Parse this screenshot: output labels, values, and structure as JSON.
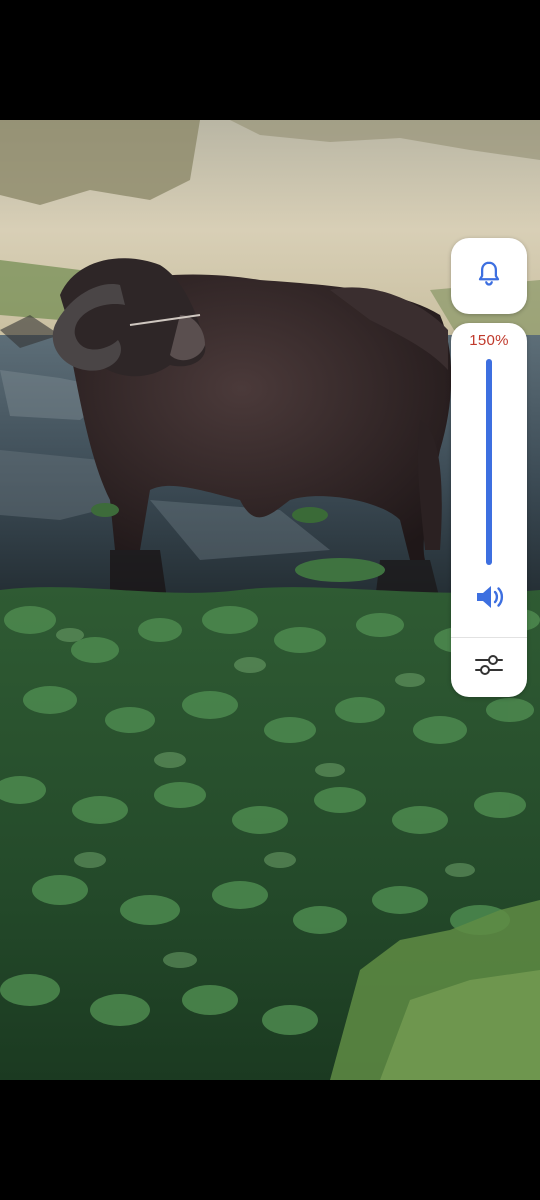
{
  "volume": {
    "percent_label": "150%",
    "level_fraction": 1.0,
    "accent_color": "#3d6fe0",
    "percent_color": "#c0392b"
  },
  "icons": {
    "ringer": "bell-icon",
    "media": "speaker-icon",
    "settings": "sliders-icon"
  },
  "photo": {
    "subject": "water-buffalo-photo"
  }
}
